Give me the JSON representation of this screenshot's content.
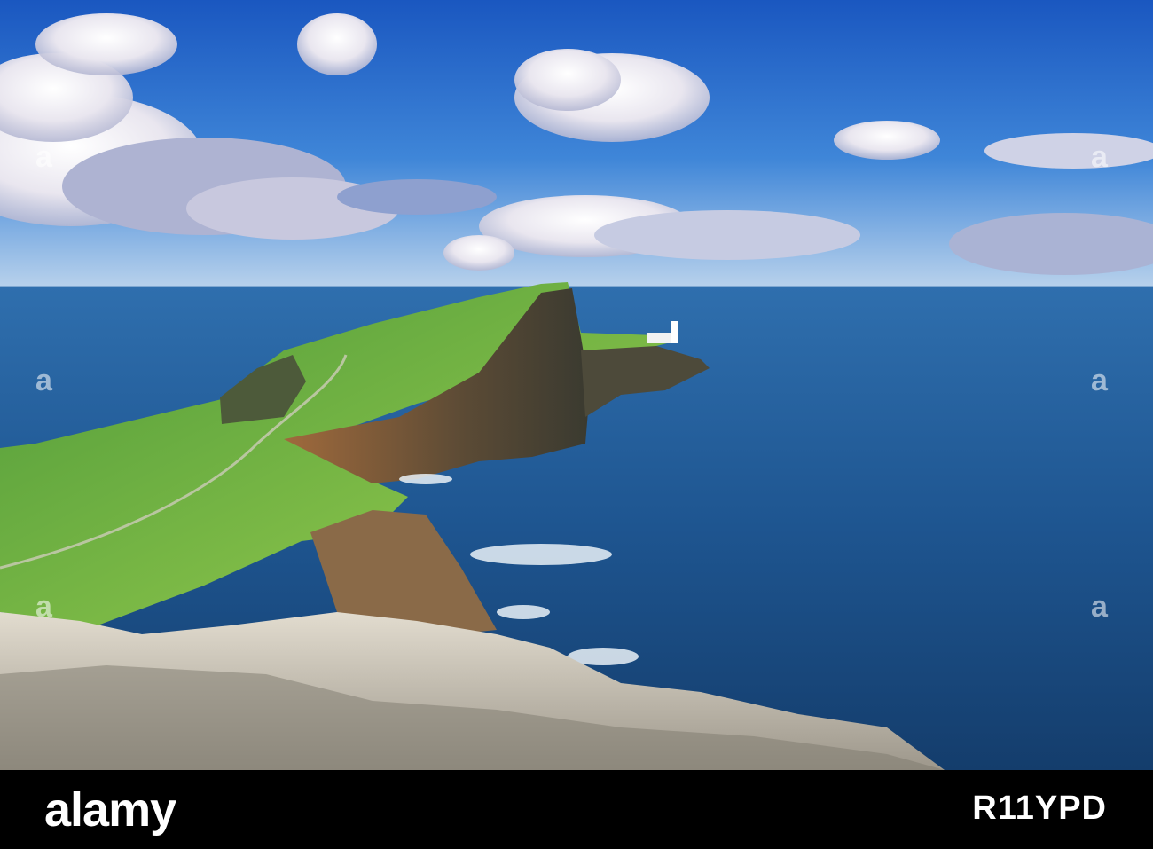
{
  "photo": {
    "subject": "Neist Point lighthouse and sea cliffs",
    "watermark": "a"
  },
  "footer": {
    "logo_text": "alamy",
    "image_id": "R11YPD"
  },
  "colors": {
    "sky_top": "#1f5fc4",
    "sky_horizon": "#b8cfe8",
    "sea": "#1c4f86",
    "grass": "#6fb24a",
    "cliff": "#7a5a3c",
    "rock": "#c9c1b4",
    "footer_bg": "#000000"
  }
}
